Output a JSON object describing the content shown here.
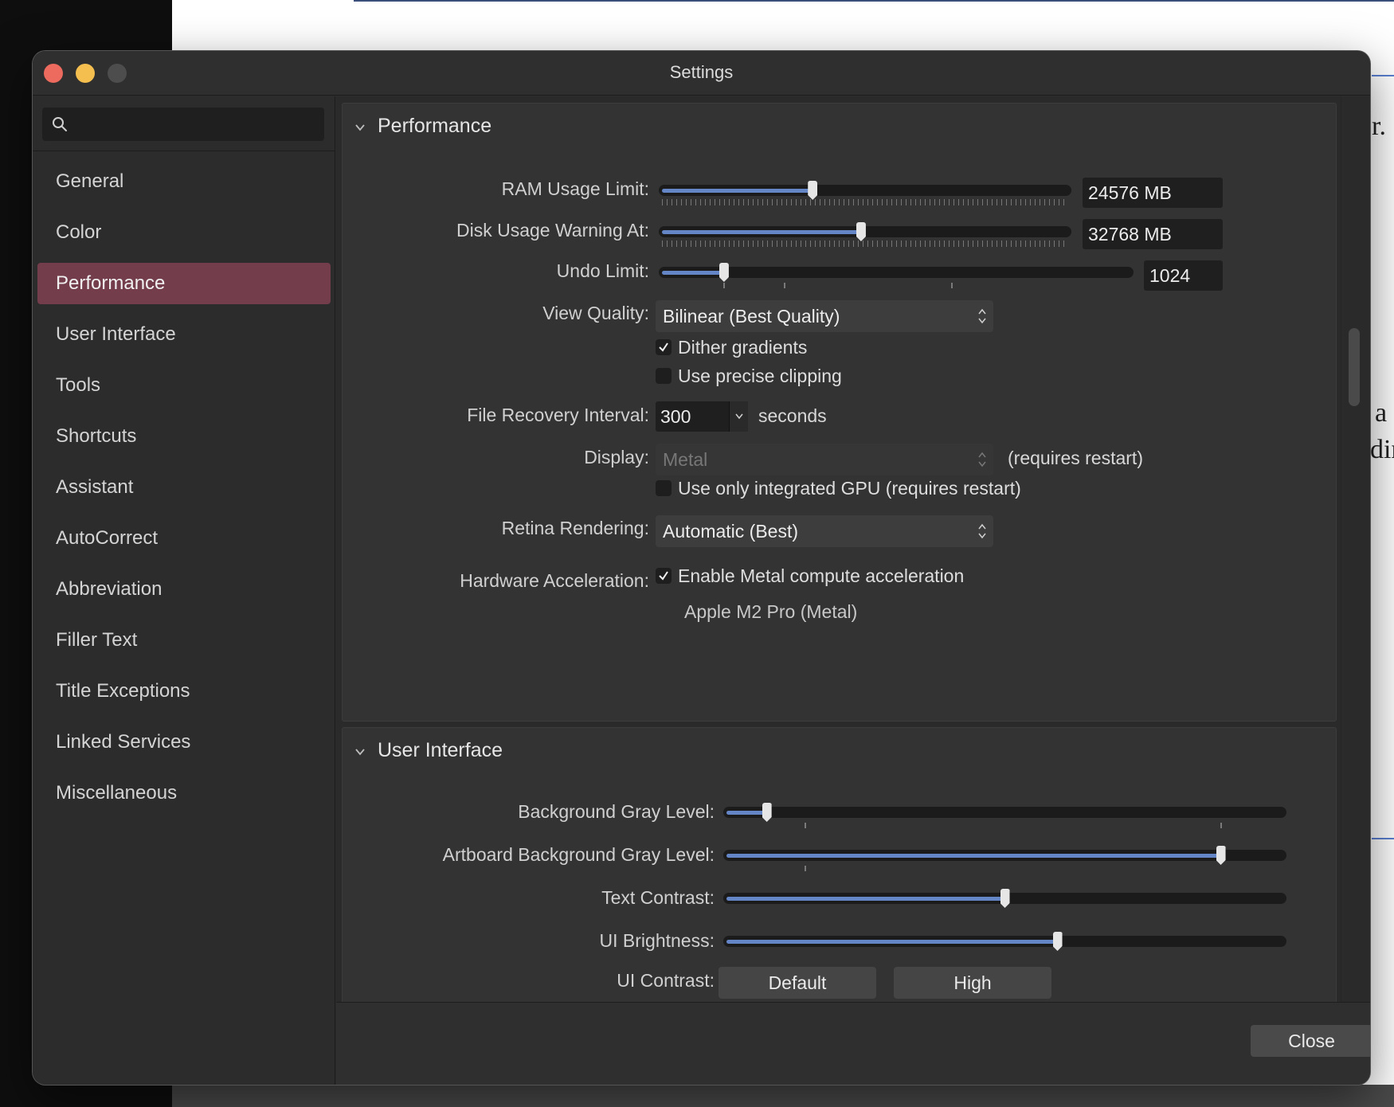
{
  "window": {
    "title": "Settings"
  },
  "background": {
    "frag1": "r.",
    "frag2": "a",
    "frag3": "dir"
  },
  "search": {
    "placeholder": "",
    "value": ""
  },
  "sidebar": {
    "items": [
      {
        "label": "General"
      },
      {
        "label": "Color"
      },
      {
        "label": "Performance",
        "active": true
      },
      {
        "label": "User Interface"
      },
      {
        "label": "Tools"
      },
      {
        "label": "Shortcuts"
      },
      {
        "label": "Assistant"
      },
      {
        "label": "AutoCorrect"
      },
      {
        "label": "Abbreviation"
      },
      {
        "label": "Filler Text"
      },
      {
        "label": "Title Exceptions"
      },
      {
        "label": "Linked Services"
      },
      {
        "label": "Miscellaneous"
      }
    ]
  },
  "performance": {
    "title": "Performance",
    "ram": {
      "label": "RAM Usage Limit:",
      "value": "24576 MB",
      "level": 0.37
    },
    "disk": {
      "label": "Disk Usage Warning At:",
      "value": "32768 MB",
      "level": 0.49
    },
    "undo": {
      "label": "Undo Limit:",
      "value": "1024",
      "level": 0.13
    },
    "view_quality": {
      "label": "View Quality:",
      "value": "Bilinear (Best Quality)"
    },
    "dither": {
      "label": "Dither gradients",
      "checked": true
    },
    "precise_clipping": {
      "label": "Use precise clipping",
      "checked": false
    },
    "recovery": {
      "label": "File Recovery Interval:",
      "value": "300",
      "unit": "seconds"
    },
    "display": {
      "label": "Display:",
      "value": "Metal",
      "note": "(requires restart)"
    },
    "integrated_gpu": {
      "label": "Use only integrated GPU (requires restart)",
      "checked": false
    },
    "retina": {
      "label": "Retina Rendering:",
      "value": "Automatic (Best)"
    },
    "hw_accel": {
      "label": "Hardware Acceleration:",
      "checkbox_label": "Enable Metal compute acceleration",
      "checked": true,
      "device": "Apple M2 Pro (Metal)"
    }
  },
  "user_interface": {
    "title": "User Interface",
    "bg_gray": {
      "label": "Background Gray Level:",
      "level": 0.07
    },
    "artboard_gray": {
      "label": "Artboard Background Gray Level:",
      "level": 0.89
    },
    "text_contrast": {
      "label": "Text Contrast:",
      "level": 0.5
    },
    "ui_brightness": {
      "label": "UI Brightness:",
      "level": 0.595
    },
    "ui_contrast": {
      "label": "UI Contrast:",
      "options": [
        "Default",
        "High"
      ]
    }
  },
  "footer": {
    "close_label": "Close"
  },
  "colors": {
    "accent_fill": "#6486c6",
    "sidebar_active": "#733d4c"
  }
}
